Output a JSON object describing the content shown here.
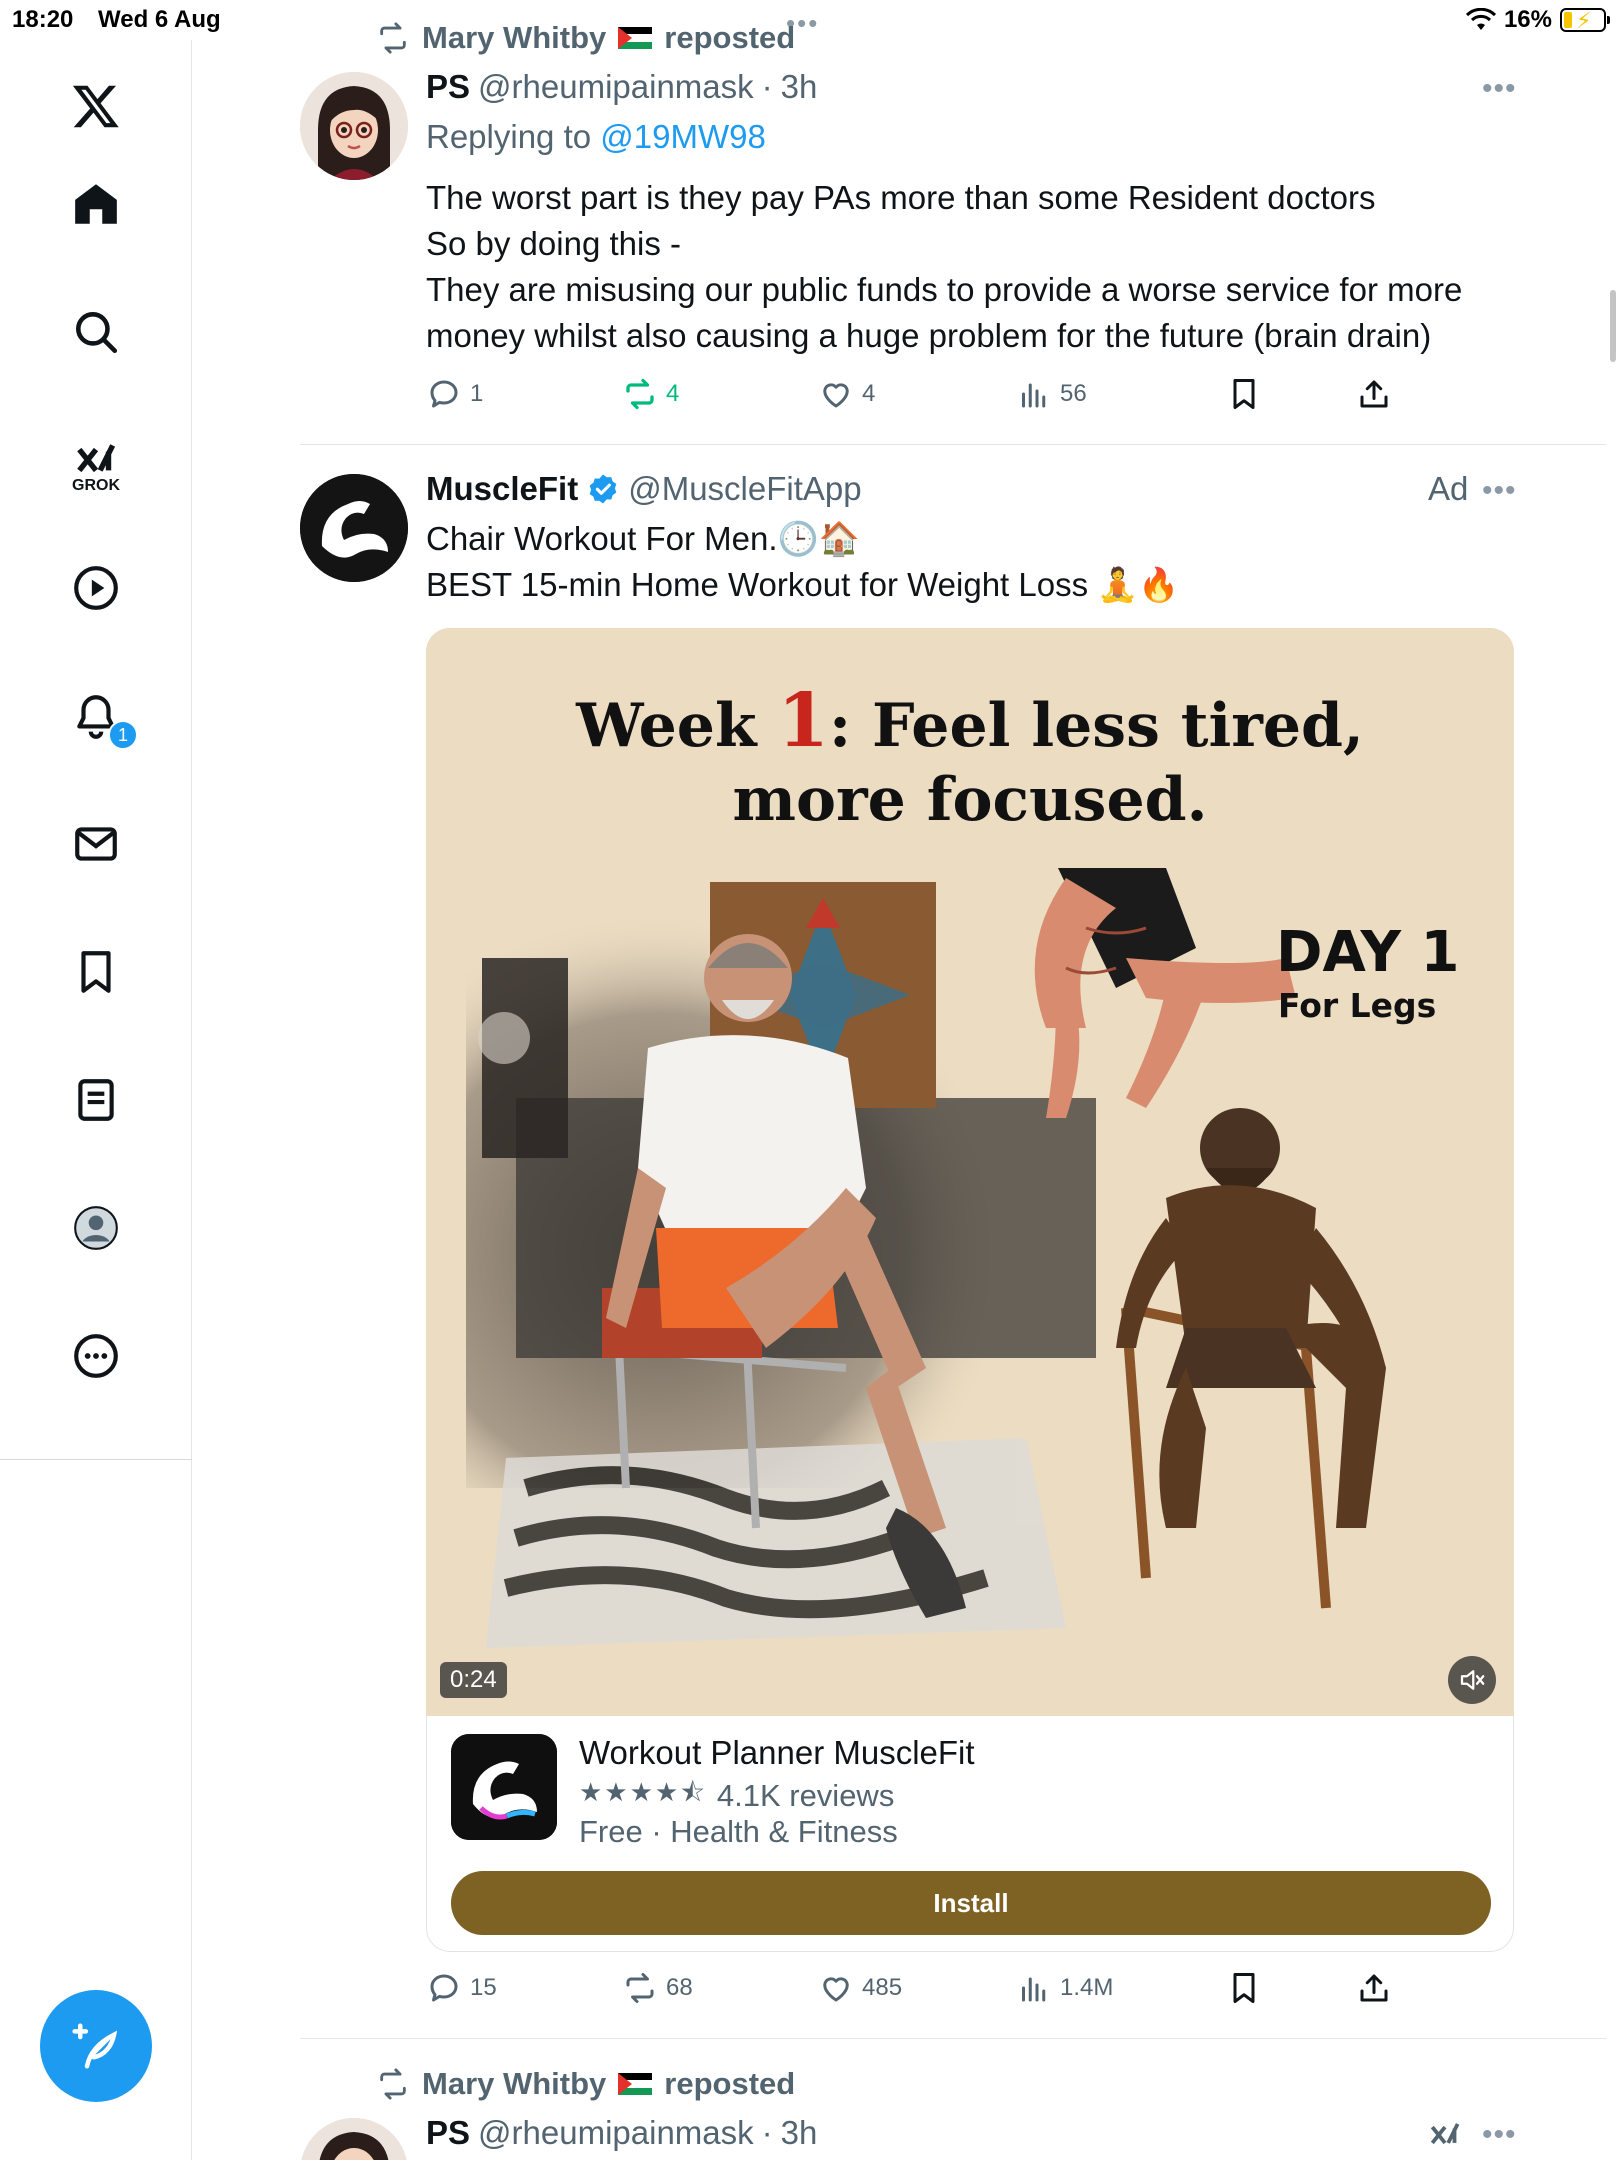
{
  "status_bar": {
    "time": "18:20",
    "date": "Wed 6 Aug",
    "battery": "16%"
  },
  "sidebar": {
    "grok_label": "GROK",
    "notification_count": "1"
  },
  "feed": {
    "tweet1": {
      "repost_by": "Mary Whitby",
      "repost_suffix": "reposted",
      "name": "PS",
      "handle": "@rheumipainmask",
      "sep": "·",
      "time": "3h",
      "replying_to_prefix": "Replying to",
      "replying_to_user": "@19MW98",
      "text_lines": [
        "The worst part is they pay PAs more than some Resident doctors",
        "So by doing this -",
        "They are misusing our public funds to provide a worse service for more",
        "money whilst also causing a huge problem for the future (brain drain)"
      ],
      "replies": "1",
      "reposts": "4",
      "likes": "4",
      "views": "56"
    },
    "tweet2": {
      "name": "MuscleFit",
      "handle": "@MuscleFitApp",
      "ad_label": "Ad",
      "text_line1": "Chair Workout For Men.🕒🏠",
      "text_line2": "BEST 15-min Home Workout for Weight Loss 🧘🔥",
      "media": {
        "title_pre": "Week ",
        "title_num": "1",
        "title_post": ": Feel less tired,",
        "title_line2": "more focused.",
        "day_title": "DAY 1",
        "day_sub": "For Legs",
        "duration": "0:24"
      },
      "card": {
        "app_name": "Workout Planner MuscleFit",
        "stars": "★★★★⯪",
        "reviews": "4.1K reviews",
        "meta": "Free · Health & Fitness",
        "install_label": "Install"
      },
      "replies": "15",
      "reposts": "68",
      "likes": "485",
      "views": "1.4M"
    },
    "tweet3": {
      "repost_by": "Mary Whitby",
      "repost_suffix": "reposted",
      "name": "PS",
      "handle": "@rheumipainmask",
      "sep": "·",
      "time": "3h"
    }
  },
  "colors": {
    "accent": "#1d9bf0",
    "repost_green": "#00ba7c",
    "install_button": "#7e6224",
    "muted_text": "#536471"
  },
  "icons": {
    "sidebar": [
      "x-logo-icon",
      "home-icon",
      "search-icon",
      "grok-icon",
      "video-icon",
      "notifications-icon",
      "messages-icon",
      "bookmarks-icon",
      "lists-icon",
      "profile-icon",
      "more-icon"
    ],
    "actions": [
      "reply-icon",
      "repost-icon",
      "like-icon",
      "views-icon",
      "bookmark-icon",
      "share-icon"
    ]
  }
}
